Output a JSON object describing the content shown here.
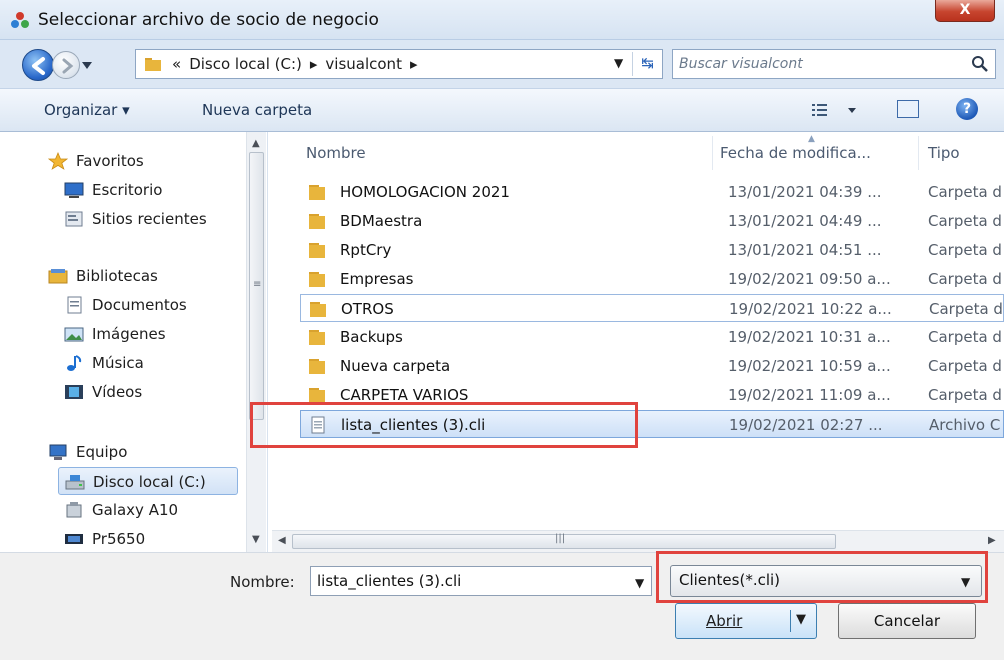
{
  "window": {
    "title": "Seleccionar archivo de socio de negocio",
    "close_label": "X"
  },
  "address": {
    "breadcrumbs": [
      "«",
      "Disco local (C:)",
      "▸",
      "visualcont",
      "▸"
    ],
    "search_placeholder": "Buscar visualcont"
  },
  "toolbar": {
    "organize_label": "Organizar ▾",
    "new_folder_label": "Nueva carpeta",
    "help_label": "?"
  },
  "sidebar": {
    "items": [
      {
        "label": "Favoritos",
        "icon": "star-icon"
      },
      {
        "label": "Escritorio",
        "icon": "desktop-icon"
      },
      {
        "label": "Sitios recientes",
        "icon": "recent-places-icon"
      },
      {
        "label": "Bibliotecas",
        "icon": "libraries-icon"
      },
      {
        "label": "Documentos",
        "icon": "documents-icon"
      },
      {
        "label": "Imágenes",
        "icon": "pictures-icon"
      },
      {
        "label": "Música",
        "icon": "music-icon"
      },
      {
        "label": "Vídeos",
        "icon": "videos-icon"
      },
      {
        "label": "Equipo",
        "icon": "computer-icon"
      },
      {
        "label": "Disco local (C:)",
        "icon": "local-disk-icon",
        "selected": true
      },
      {
        "label": "Galaxy A10",
        "icon": "phone-device-icon"
      },
      {
        "label": "Pr5650",
        "icon": "printer-device-icon"
      }
    ]
  },
  "file_list": {
    "columns": [
      "Nombre",
      "Fecha de modifica...",
      "Tipo"
    ],
    "rows": [
      {
        "name": "HOMOLOGACION 2021",
        "date": "13/01/2021 04:39 ...",
        "type": "Carpeta d",
        "kind": "folder"
      },
      {
        "name": "BDMaestra",
        "date": "13/01/2021 04:49 ...",
        "type": "Carpeta d",
        "kind": "folder"
      },
      {
        "name": "RptCry",
        "date": "13/01/2021 04:51 ...",
        "type": "Carpeta d",
        "kind": "folder"
      },
      {
        "name": "Empresas",
        "date": "19/02/2021 09:50 a...",
        "type": "Carpeta d",
        "kind": "folder"
      },
      {
        "name": "OTROS",
        "date": "19/02/2021 10:22 a...",
        "type": "Carpeta d",
        "kind": "folder"
      },
      {
        "name": "Backups",
        "date": "19/02/2021 10:31 a...",
        "type": "Carpeta d",
        "kind": "folder"
      },
      {
        "name": "Nueva carpeta",
        "date": "19/02/2021 10:59 a...",
        "type": "Carpeta d",
        "kind": "folder"
      },
      {
        "name": "CARPETA VARIOS",
        "date": "19/02/2021 11:09 a...",
        "type": "Carpeta d",
        "kind": "folder"
      },
      {
        "name": "lista_clientes (3).cli",
        "date": "19/02/2021 02:27 ...",
        "type": "Archivo C",
        "kind": "file"
      }
    ]
  },
  "bottom": {
    "filename_label": "Nombre:",
    "filename_value": "lista_clientes (3).cli",
    "filetype_value": "Clientes(*.cli)",
    "open_label": "Abrir",
    "cancel_label": "Cancelar"
  },
  "colors": {
    "highlight": "#e0433e",
    "selection": "#cde0f7",
    "folder": "#e8b53c"
  }
}
